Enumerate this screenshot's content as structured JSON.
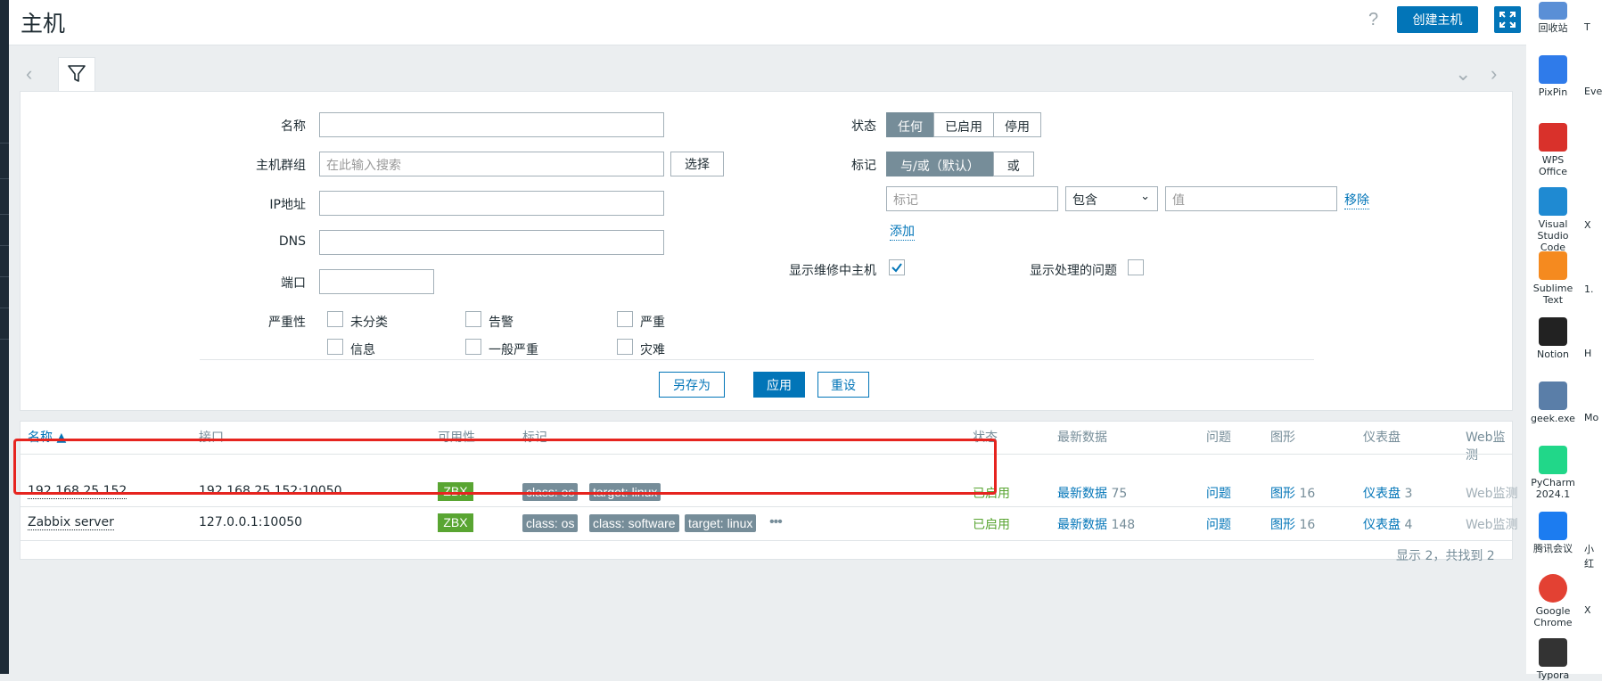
{
  "page": {
    "title": "主机",
    "help": "?",
    "create_host": "创建主机"
  },
  "filter": {
    "labels": {
      "name": "名称",
      "host_group": "主机群组",
      "ip": "IP地址",
      "dns": "DNS",
      "port": "端口",
      "severity": "严重性",
      "status": "状态",
      "tags": "标记",
      "show_maintenance": "显示维修中主机",
      "show_suppressed": "显示处理的问题"
    },
    "host_group_placeholder": "在此输入搜索",
    "select_button": "选择",
    "status_options": [
      "任何",
      "已启用",
      "停用"
    ],
    "tag_mode_options": [
      "与/或（默认）",
      "或"
    ],
    "tag_placeholder": "标记",
    "tag_operator": "包含",
    "tag_value_placeholder": "值",
    "remove": "移除",
    "add": "添加",
    "severities": [
      "未分类",
      "告警",
      "严重",
      "信息",
      "一般严重",
      "灾难"
    ],
    "show_maintenance_checked": true,
    "show_suppressed_checked": false,
    "buttons": {
      "save_as": "另存为",
      "apply": "应用",
      "reset": "重设"
    }
  },
  "table": {
    "headers": [
      "名称 ▲",
      "接口",
      "可用性",
      "标记",
      "状态",
      "最新数据",
      "问题",
      "图形",
      "仪表盘",
      "Web监测"
    ],
    "rows": [
      {
        "name": "192.168.25.152",
        "interface": "192.168.25.152:10050",
        "availability": "ZBX",
        "tags": [
          "class: os",
          "target: linux"
        ],
        "status": "已启用",
        "latest_label": "最新数据",
        "latest_count": "75",
        "problems": "问题",
        "graphs_label": "图形",
        "graphs_count": "16",
        "dash_label": "仪表盘",
        "dash_count": "3",
        "web": "Web监测"
      },
      {
        "name": "Zabbix server",
        "interface": "127.0.0.1:10050",
        "availability": "ZBX",
        "tags": [
          "class: os",
          "class: software",
          "target: linux"
        ],
        "more": "•••",
        "status": "已启用",
        "latest_label": "最新数据",
        "latest_count": "148",
        "problems": "问题",
        "graphs_label": "图形",
        "graphs_count": "16",
        "dash_label": "仪表盘",
        "dash_count": "4",
        "web": "Web监测"
      }
    ],
    "footer": "显示 2，共找到 2"
  },
  "desktop": {
    "icons": [
      {
        "label": "回收站",
        "color": "#5a8fd6"
      },
      {
        "label": "PixPin",
        "color": "#2f7bea"
      },
      {
        "label": "WPS Office",
        "color": "#d9312b"
      },
      {
        "label": "Visual Studio Code",
        "color": "#1f8ad2"
      },
      {
        "label": "Sublime Text",
        "color": "#f58a1f"
      },
      {
        "label": "Notion",
        "color": "#222222"
      },
      {
        "label": "geek.exe",
        "color": "#5a7ea8"
      },
      {
        "label": "PyCharm 2024.1",
        "color": "#21d789"
      },
      {
        "label": "腾讯会议",
        "color": "#1c7cf0"
      },
      {
        "label": "Google Chrome",
        "color": "#e34133"
      },
      {
        "label": "Typora",
        "color": "#333333"
      }
    ],
    "edge_texts": [
      "T",
      "Eve",
      "X",
      "X",
      "1.",
      "H",
      "Mo",
      "小红",
      "X"
    ]
  },
  "colors": {
    "primary": "#0275b8",
    "enabled": "#59a532",
    "tag": "#768d99",
    "highlight": "#e6241f"
  }
}
